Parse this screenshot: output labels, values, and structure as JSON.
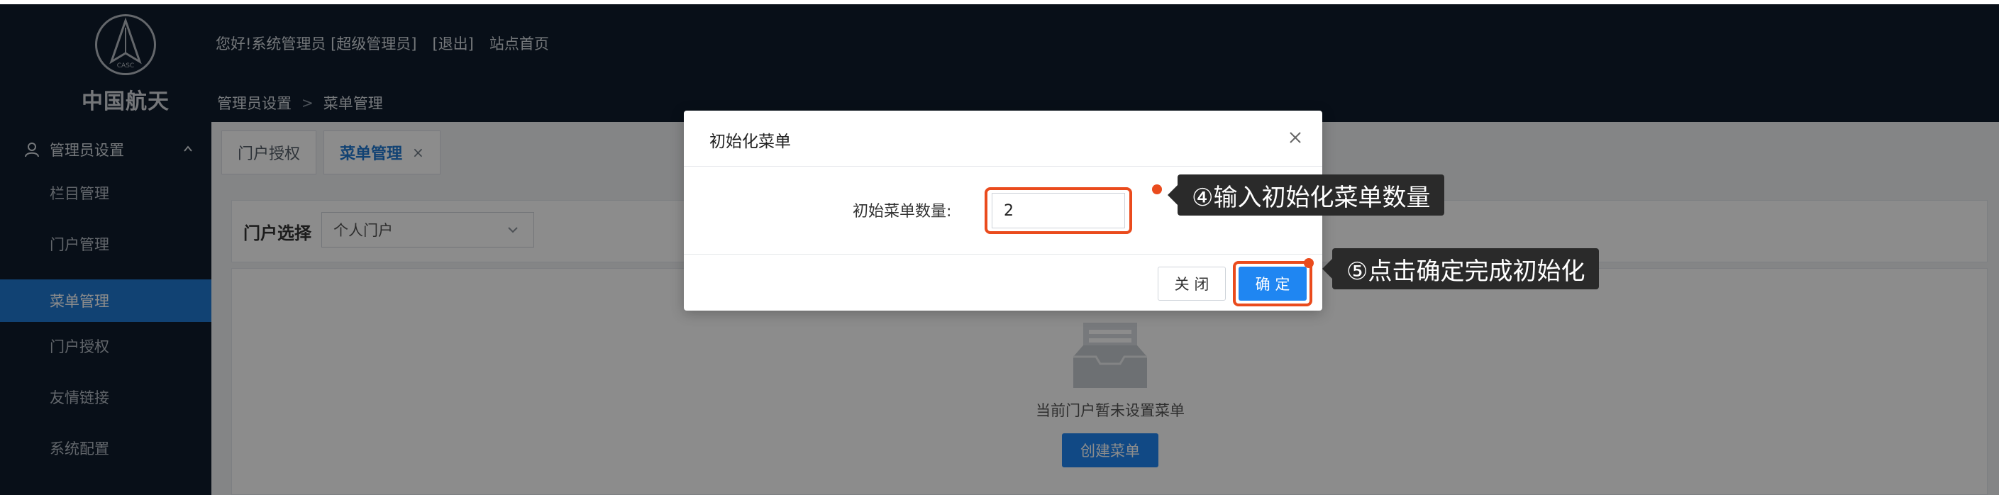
{
  "brand": {
    "name": "中国航天",
    "emblem_text": "CASC"
  },
  "header": {
    "greeting": "您好!",
    "user": "系统管理员 [超级管理员]",
    "logout": "[退出]",
    "home": "站点首页"
  },
  "breadcrumb": {
    "section": "管理员设置",
    "separator": ">",
    "page": "菜单管理"
  },
  "sidebar": {
    "group": "管理员设置",
    "items": [
      {
        "label": "栏目管理",
        "active": false
      },
      {
        "label": "门户管理",
        "active": false
      },
      {
        "label": "菜单管理",
        "active": true
      },
      {
        "label": "门户授权",
        "active": false
      },
      {
        "label": "友情链接",
        "active": false
      },
      {
        "label": "系统配置",
        "active": false
      }
    ]
  },
  "tabs": [
    {
      "label": "门户授权"
    },
    {
      "label": "菜单管理",
      "active": true,
      "close": "×"
    }
  ],
  "filter": {
    "label": "门户选择",
    "selected": "个人门户"
  },
  "empty_state": {
    "message": "当前门户暂未设置菜单",
    "create_button": "创建菜单"
  },
  "dialog": {
    "title": "初始化菜单",
    "field_label": "初始菜单数量:",
    "field_value": "2",
    "cancel": "关 闭",
    "confirm": "确 定"
  },
  "callouts": {
    "step4": "④输入初始化菜单数量",
    "step5": "⑤点击确定完成初始化"
  },
  "colors": {
    "header_bg": "#0f1d2c",
    "accent": "#1f86f2",
    "highlight": "#ea4b1d",
    "callout_bg": "#2a2a2a"
  }
}
